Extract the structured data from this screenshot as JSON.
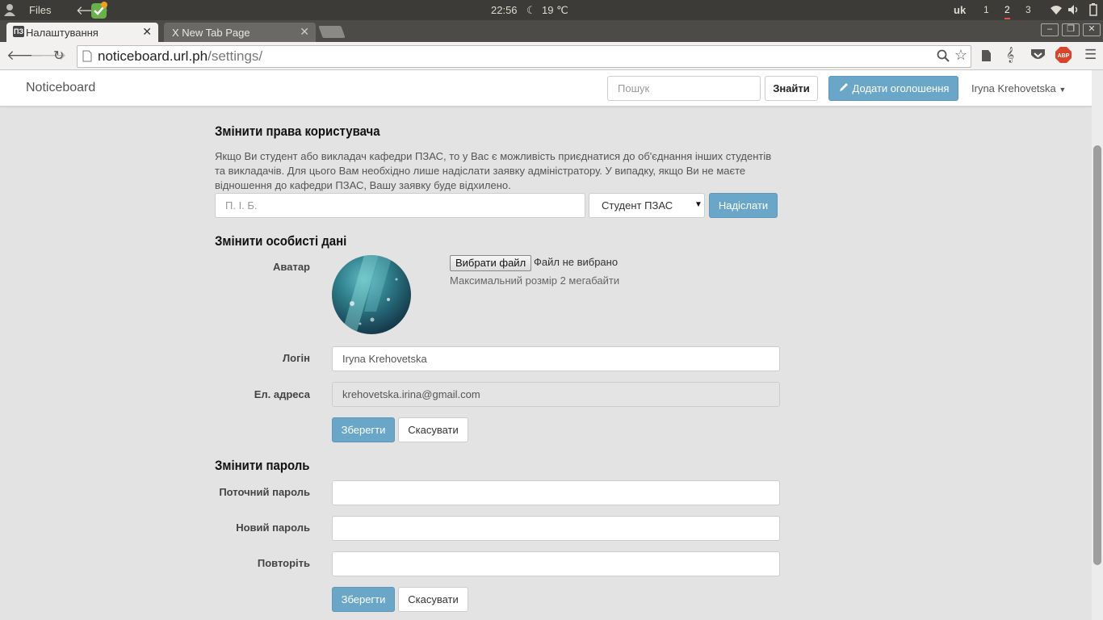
{
  "os_panel": {
    "app_name": "Files",
    "time": "22:56",
    "weather": "19 ℃",
    "keyboard_layout": "uk",
    "workspaces": [
      "1",
      "2",
      "3"
    ],
    "active_workspace": "2"
  },
  "browser": {
    "tabs": [
      {
        "label": "Налаштування",
        "favicon": "ПЗ",
        "active": true
      },
      {
        "label": "X New Tab Page",
        "active": false
      }
    ],
    "url_host": "noticeboard.url.ph",
    "url_path": "/settings/",
    "extension_badge": "ABP"
  },
  "navbar": {
    "brand": "Noticeboard",
    "search_placeholder": "Пошук",
    "search_button": "Знайти",
    "add_button": "Додати оголошення",
    "user_name": "Iryna Krehovetska"
  },
  "rights_section": {
    "title": "Змінити права користувача",
    "description": "Якщо Ви студент або викладач кафедри ПЗАС, то у Вас є можливість приєднатися до об'єднання інших студентів та викладачів. Для цього Вам необхідно лише надіслати заявку адміністратору. У випадку, якщо Ви не маєте відношення до кафедри ПЗАС, Вашу заявку буде відхилено.",
    "name_placeholder": "П. І. Б.",
    "role_selected": "Студент ПЗАС",
    "submit_button": "Надіслати"
  },
  "personal_section": {
    "title": "Змінити особисті дані",
    "avatar_label": "Аватар",
    "choose_file_button": "Вибрати файл",
    "file_status": "Файл не вибрано",
    "file_hint": "Максимальний розмір 2 мегабайти",
    "login_label": "Логін",
    "login_value": "Iryna Krehovetska",
    "email_label": "Ел. адреса",
    "email_value": "krehovetska.irina@gmail.com",
    "save_button": "Зберегти",
    "cancel_button": "Скасувати"
  },
  "password_section": {
    "title": "Змінити пароль",
    "current_label": "Поточний пароль",
    "new_label": "Новий пароль",
    "repeat_label": "Повторіть",
    "save_button": "Зберегти",
    "cancel_button": "Скасувати"
  },
  "colors": {
    "primary_button": "#6aa6c8",
    "os_panel": "#3c3b37",
    "active_workspace_underline": "#e0583c"
  }
}
